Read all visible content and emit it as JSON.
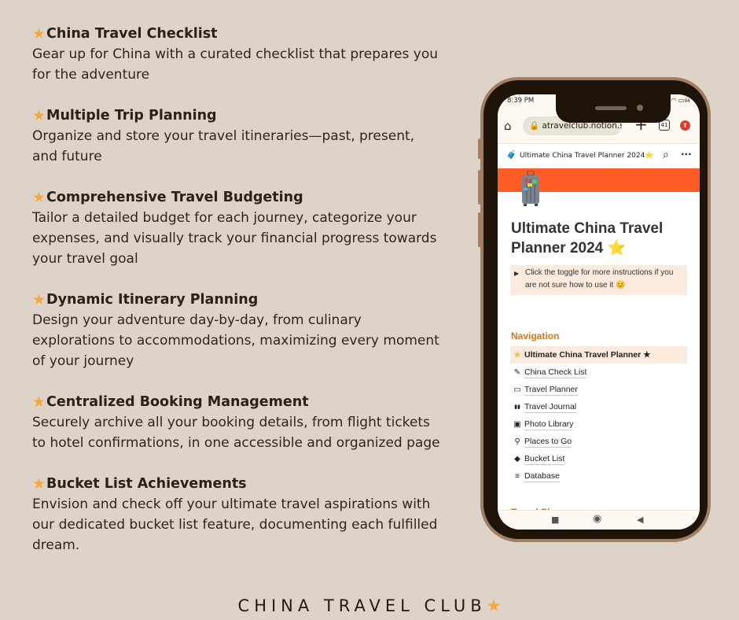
{
  "features": [
    {
      "title": "China Travel Checklist",
      "desc": "Gear up for China with a curated checklist that prepares you for the adventure"
    },
    {
      "title": "Multiple Trip Planning",
      "desc": "Organize and store your travel itineraries—past, present, and future"
    },
    {
      "title": "Comprehensive Travel Budgeting",
      "desc": "Tailor a detailed budget for each journey, categorize your expenses, and visually track your financial progress towards your travel goal"
    },
    {
      "title": "Dynamic Itinerary Planning",
      "desc": "Design your adventure day-by-day, from culinary explorations to accommodations, maximizing every moment of your journey"
    },
    {
      "title": "Centralized Booking Management",
      "desc": "Securely archive all your booking details, from flight tickets to hotel confirmations, in one accessible and organized page"
    },
    {
      "title": "Bucket List Achievements",
      "desc": "Envision and check off your ultimate travel aspirations with our dedicated bucket list feature, documenting each fulfilled dream."
    }
  ],
  "star_glyph": "★",
  "footer": {
    "brand": "CHINA TRAVEL CLUB",
    "star": "★"
  },
  "phone": {
    "status": {
      "time": "8:39 PM",
      "battery": "94"
    },
    "browser": {
      "url": "atravelclub.notion.site",
      "tab_count": "41"
    },
    "notion_bar": {
      "title": "Ultimate China Travel Planner 2024⭐"
    },
    "page_title": "Ultimate China Travel Planner 2024 ⭐",
    "callout": "Click the toggle for more instructions if you are not sure how to use it 😊",
    "nav_heading": "Navigation",
    "nav_items": [
      {
        "icon": "★",
        "label": "Ultimate  China Travel Planner ★",
        "icon_name": "star-icon"
      },
      {
        "icon": "✎",
        "label": "China Check List",
        "icon_name": "edit-checklist-icon"
      },
      {
        "icon": "▭",
        "label": "Travel Planner",
        "icon_name": "calendar-icon"
      },
      {
        "icon": "▮▮",
        "label": "Travel Journal",
        "icon_name": "book-icon"
      },
      {
        "icon": "▣",
        "label": "Photo Library",
        "icon_name": "image-icon"
      },
      {
        "icon": "⚲",
        "label": "Places to Go",
        "icon_name": "map-pin-icon"
      },
      {
        "icon": "◆",
        "label": "Bucket List",
        "icon_name": "tag-icon"
      },
      {
        "icon": "≡",
        "label": "Database",
        "icon_name": "database-icon"
      }
    ],
    "section2_heading": "Travel Planner"
  }
}
